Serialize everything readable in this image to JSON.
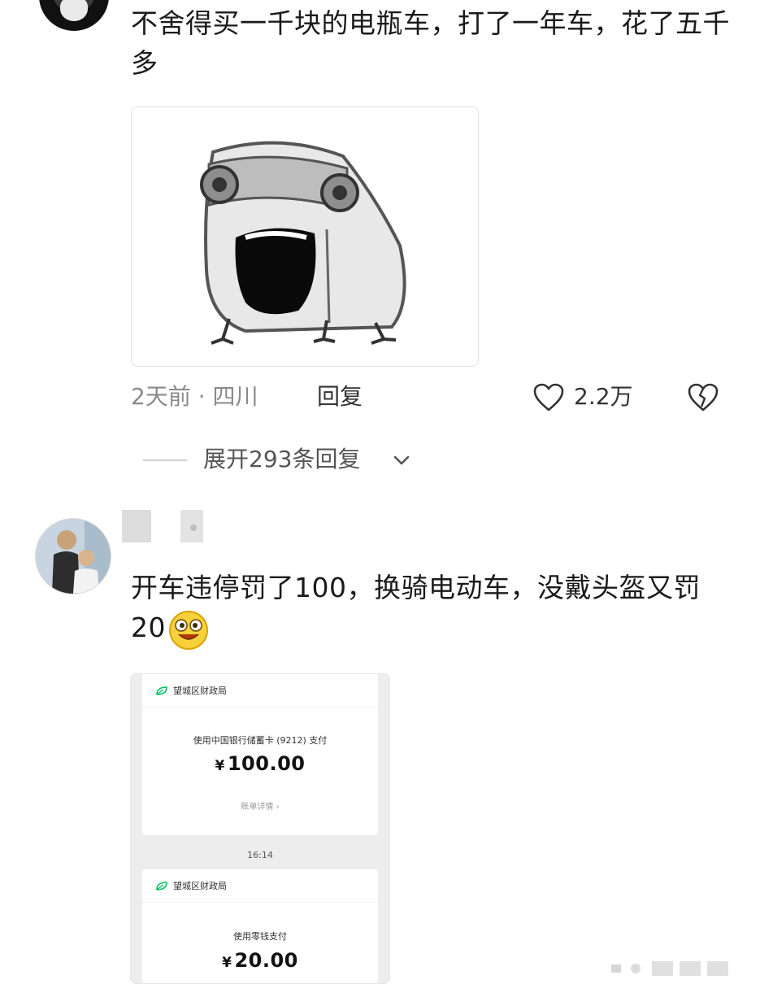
{
  "comment1": {
    "text": "不舍得买一千块的电瓶车，打了一年车，花了五千多",
    "time_location": "2天前 · 四川",
    "reply_label": "回复",
    "likes": "2.2万",
    "expand_label": "展开293条回复"
  },
  "comment2": {
    "text": "开车违停罚了100，换骑电动车，没戴头盔又罚20",
    "emoji": "smiley-emoji"
  },
  "payment": {
    "merchant": "望城区财政局",
    "card1": {
      "method": "使用中国银行储蓄卡 (9212) 支付",
      "currency": "¥",
      "amount": "100.00",
      "detail": "账单详情 ›"
    },
    "time": "16:14",
    "card2": {
      "method": "使用零钱支付",
      "currency": "¥",
      "amount": "20.00"
    }
  },
  "colors": {
    "text": "#1a1a1a",
    "meta": "#8a8a8a",
    "brand_green": "#07c160"
  }
}
